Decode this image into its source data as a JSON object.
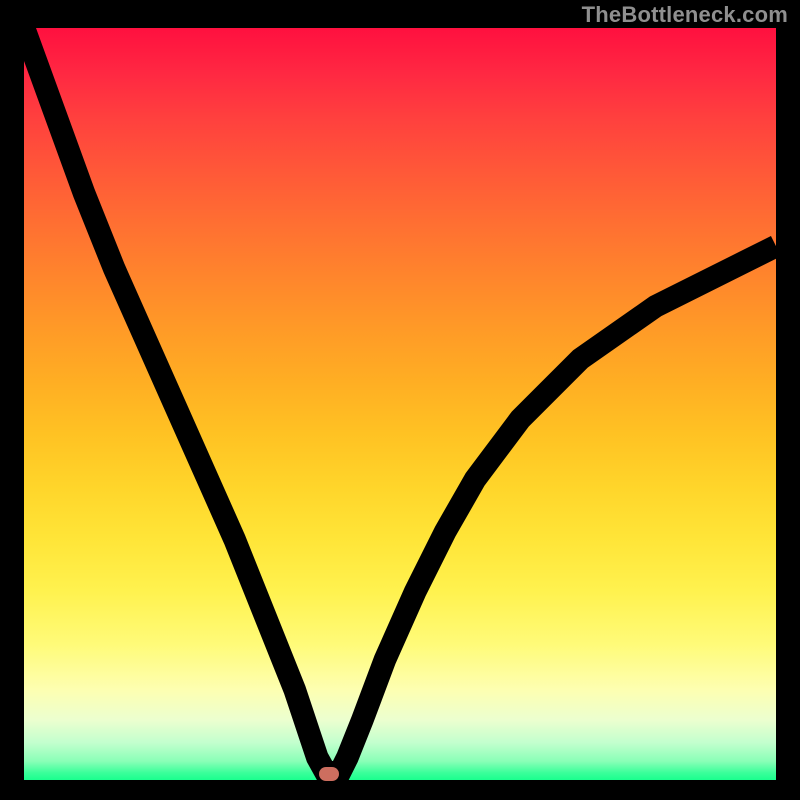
{
  "watermark": "TheBottleneck.com",
  "chart_data": {
    "type": "line",
    "title": "",
    "xlabel": "",
    "ylabel": "",
    "xlim": [
      0,
      100
    ],
    "ylim": [
      0,
      100
    ],
    "grid": false,
    "colors": {
      "curve": "#000000",
      "marker": "#cd6e5f",
      "gradient_top": "#ff103f",
      "gradient_mid": "#ffdb2e",
      "gradient_bottom": "#1aff8e"
    },
    "marker": {
      "x": 40.5,
      "y": 0.8
    },
    "series": [
      {
        "name": "bottleneck-curve",
        "x": [
          0,
          4,
          8,
          12,
          16,
          20,
          24,
          28,
          32,
          34,
          36,
          37,
          38,
          39,
          40,
          41,
          42,
          43,
          45,
          48,
          52,
          56,
          60,
          66,
          74,
          84,
          96,
          100
        ],
        "values": [
          100,
          89,
          78,
          68,
          59,
          50,
          41,
          32,
          22,
          17,
          12,
          9,
          6,
          3,
          1.2,
          1,
          1,
          3,
          8,
          16,
          25,
          33,
          40,
          48,
          56,
          63,
          69,
          71
        ]
      }
    ]
  }
}
